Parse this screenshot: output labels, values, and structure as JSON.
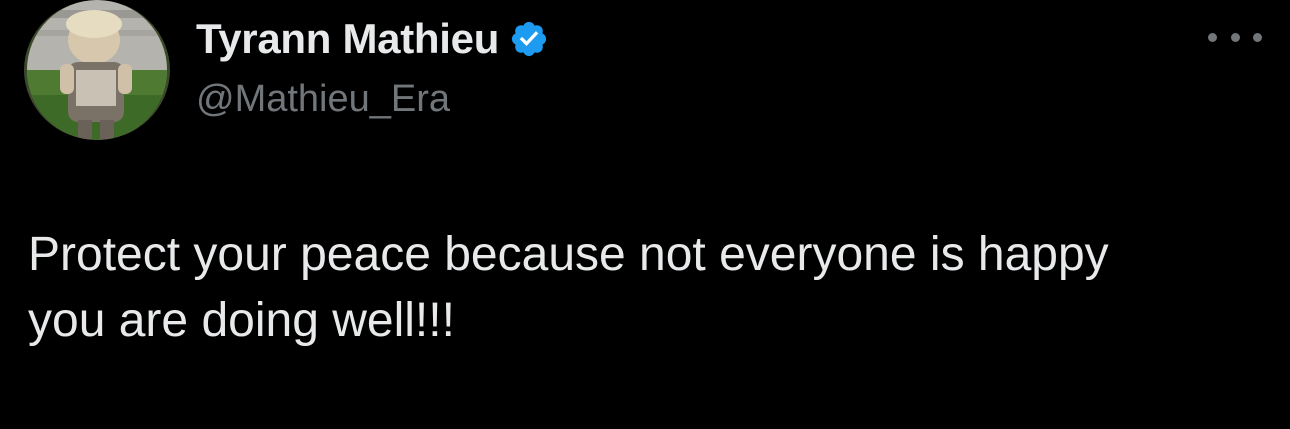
{
  "tweet": {
    "author": {
      "display_name": "Tyrann Mathieu",
      "handle": "@Mathieu_Era",
      "verified": true,
      "verified_icon": "verified-badge-icon",
      "avatar": "profile-photo"
    },
    "more_icon": "more-options-icon",
    "text_line_1": "Protect your peace because not everyone is happy",
    "text_line_2": "you are doing well!!!"
  },
  "colors": {
    "background": "#000000",
    "primary_text": "#e7e9ea",
    "secondary_text": "#71767b",
    "verified_blue": "#1d9bf0"
  }
}
